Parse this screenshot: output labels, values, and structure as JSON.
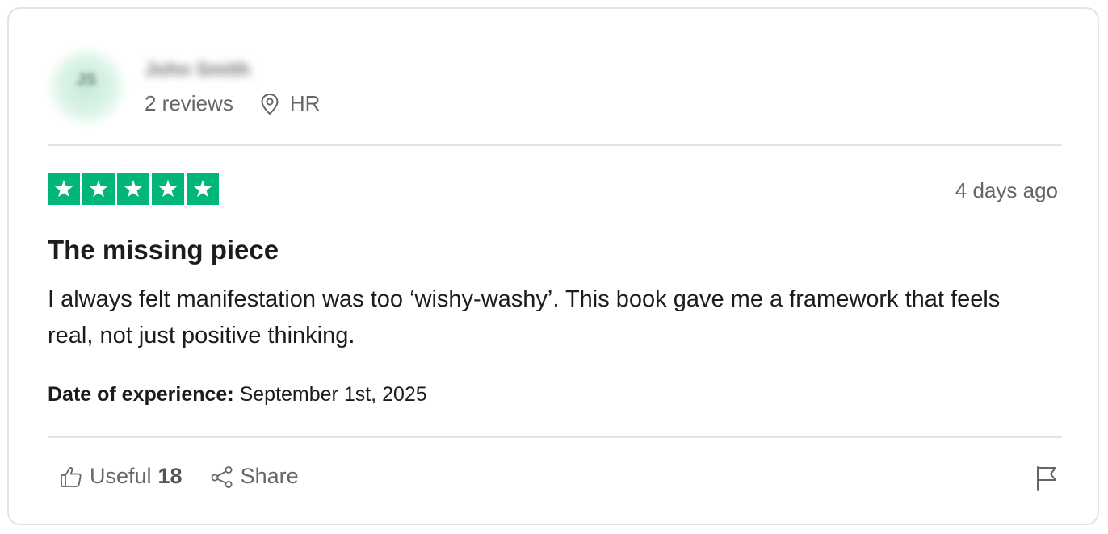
{
  "reviewer": {
    "initials": "JS",
    "name": "John Smith",
    "reviews_count": "2 reviews",
    "country": "HR",
    "avatar_color": "#d9f3e5"
  },
  "review": {
    "rating": 5,
    "date_relative": "4 days ago",
    "title": "The missing piece",
    "body": "I always felt manifestation was too ‘wishy-washy’. This book gave me a framework that feels real, not just positive thinking.",
    "experience_label": "Date of experience:",
    "experience_date": "September 1st, 2025",
    "star_color": "#00b67a"
  },
  "actions": {
    "useful_label": "Useful",
    "useful_count": "18",
    "share_label": "Share",
    "icons": [
      "thumbs-up-icon",
      "share-icon",
      "flag-icon",
      "location-pin-icon",
      "star-icon"
    ]
  }
}
